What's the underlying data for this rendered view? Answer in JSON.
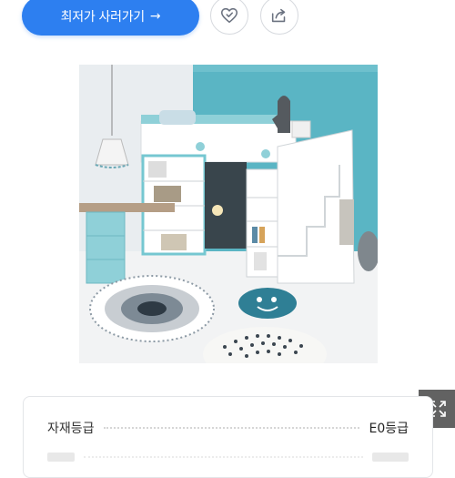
{
  "cta": {
    "label": "최저가 사러가기",
    "arrow": "→"
  },
  "icons": {
    "wishlist": "heart-check-icon",
    "share": "share-icon",
    "zoom": "expand-icon"
  },
  "product_image": {
    "alt": "loft bed with desk, shelves and stairs"
  },
  "specs": [
    {
      "label": "자재등급",
      "value": "E0등급"
    }
  ],
  "colors": {
    "accent": "#2d7ff0"
  }
}
